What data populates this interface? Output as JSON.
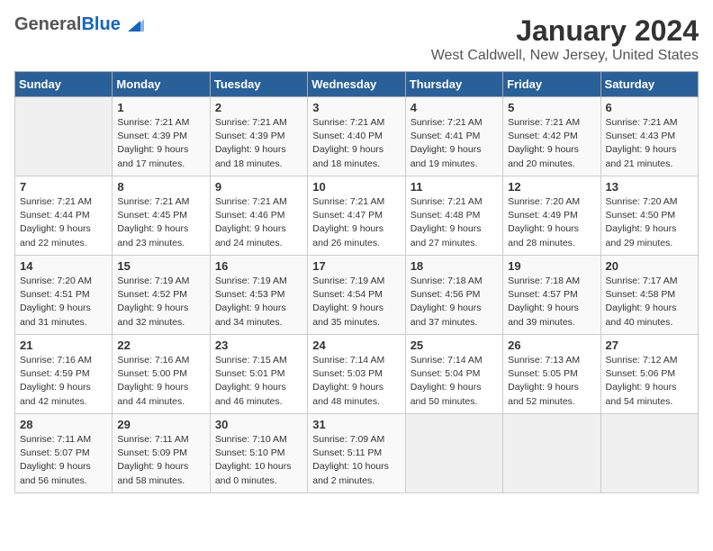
{
  "header": {
    "logo_general": "General",
    "logo_blue": "Blue",
    "month_title": "January 2024",
    "location": "West Caldwell, New Jersey, United States"
  },
  "days_of_week": [
    "Sunday",
    "Monday",
    "Tuesday",
    "Wednesday",
    "Thursday",
    "Friday",
    "Saturday"
  ],
  "weeks": [
    [
      {
        "day": "",
        "info": ""
      },
      {
        "day": "1",
        "info": "Sunrise: 7:21 AM\nSunset: 4:39 PM\nDaylight: 9 hours\nand 17 minutes."
      },
      {
        "day": "2",
        "info": "Sunrise: 7:21 AM\nSunset: 4:39 PM\nDaylight: 9 hours\nand 18 minutes."
      },
      {
        "day": "3",
        "info": "Sunrise: 7:21 AM\nSunset: 4:40 PM\nDaylight: 9 hours\nand 18 minutes."
      },
      {
        "day": "4",
        "info": "Sunrise: 7:21 AM\nSunset: 4:41 PM\nDaylight: 9 hours\nand 19 minutes."
      },
      {
        "day": "5",
        "info": "Sunrise: 7:21 AM\nSunset: 4:42 PM\nDaylight: 9 hours\nand 20 minutes."
      },
      {
        "day": "6",
        "info": "Sunrise: 7:21 AM\nSunset: 4:43 PM\nDaylight: 9 hours\nand 21 minutes."
      }
    ],
    [
      {
        "day": "7",
        "info": "Sunrise: 7:21 AM\nSunset: 4:44 PM\nDaylight: 9 hours\nand 22 minutes."
      },
      {
        "day": "8",
        "info": "Sunrise: 7:21 AM\nSunset: 4:45 PM\nDaylight: 9 hours\nand 23 minutes."
      },
      {
        "day": "9",
        "info": "Sunrise: 7:21 AM\nSunset: 4:46 PM\nDaylight: 9 hours\nand 24 minutes."
      },
      {
        "day": "10",
        "info": "Sunrise: 7:21 AM\nSunset: 4:47 PM\nDaylight: 9 hours\nand 26 minutes."
      },
      {
        "day": "11",
        "info": "Sunrise: 7:21 AM\nSunset: 4:48 PM\nDaylight: 9 hours\nand 27 minutes."
      },
      {
        "day": "12",
        "info": "Sunrise: 7:20 AM\nSunset: 4:49 PM\nDaylight: 9 hours\nand 28 minutes."
      },
      {
        "day": "13",
        "info": "Sunrise: 7:20 AM\nSunset: 4:50 PM\nDaylight: 9 hours\nand 29 minutes."
      }
    ],
    [
      {
        "day": "14",
        "info": "Sunrise: 7:20 AM\nSunset: 4:51 PM\nDaylight: 9 hours\nand 31 minutes."
      },
      {
        "day": "15",
        "info": "Sunrise: 7:19 AM\nSunset: 4:52 PM\nDaylight: 9 hours\nand 32 minutes."
      },
      {
        "day": "16",
        "info": "Sunrise: 7:19 AM\nSunset: 4:53 PM\nDaylight: 9 hours\nand 34 minutes."
      },
      {
        "day": "17",
        "info": "Sunrise: 7:19 AM\nSunset: 4:54 PM\nDaylight: 9 hours\nand 35 minutes."
      },
      {
        "day": "18",
        "info": "Sunrise: 7:18 AM\nSunset: 4:56 PM\nDaylight: 9 hours\nand 37 minutes."
      },
      {
        "day": "19",
        "info": "Sunrise: 7:18 AM\nSunset: 4:57 PM\nDaylight: 9 hours\nand 39 minutes."
      },
      {
        "day": "20",
        "info": "Sunrise: 7:17 AM\nSunset: 4:58 PM\nDaylight: 9 hours\nand 40 minutes."
      }
    ],
    [
      {
        "day": "21",
        "info": "Sunrise: 7:16 AM\nSunset: 4:59 PM\nDaylight: 9 hours\nand 42 minutes."
      },
      {
        "day": "22",
        "info": "Sunrise: 7:16 AM\nSunset: 5:00 PM\nDaylight: 9 hours\nand 44 minutes."
      },
      {
        "day": "23",
        "info": "Sunrise: 7:15 AM\nSunset: 5:01 PM\nDaylight: 9 hours\nand 46 minutes."
      },
      {
        "day": "24",
        "info": "Sunrise: 7:14 AM\nSunset: 5:03 PM\nDaylight: 9 hours\nand 48 minutes."
      },
      {
        "day": "25",
        "info": "Sunrise: 7:14 AM\nSunset: 5:04 PM\nDaylight: 9 hours\nand 50 minutes."
      },
      {
        "day": "26",
        "info": "Sunrise: 7:13 AM\nSunset: 5:05 PM\nDaylight: 9 hours\nand 52 minutes."
      },
      {
        "day": "27",
        "info": "Sunrise: 7:12 AM\nSunset: 5:06 PM\nDaylight: 9 hours\nand 54 minutes."
      }
    ],
    [
      {
        "day": "28",
        "info": "Sunrise: 7:11 AM\nSunset: 5:07 PM\nDaylight: 9 hours\nand 56 minutes."
      },
      {
        "day": "29",
        "info": "Sunrise: 7:11 AM\nSunset: 5:09 PM\nDaylight: 9 hours\nand 58 minutes."
      },
      {
        "day": "30",
        "info": "Sunrise: 7:10 AM\nSunset: 5:10 PM\nDaylight: 10 hours\nand 0 minutes."
      },
      {
        "day": "31",
        "info": "Sunrise: 7:09 AM\nSunset: 5:11 PM\nDaylight: 10 hours\nand 2 minutes."
      },
      {
        "day": "",
        "info": ""
      },
      {
        "day": "",
        "info": ""
      },
      {
        "day": "",
        "info": ""
      }
    ]
  ]
}
